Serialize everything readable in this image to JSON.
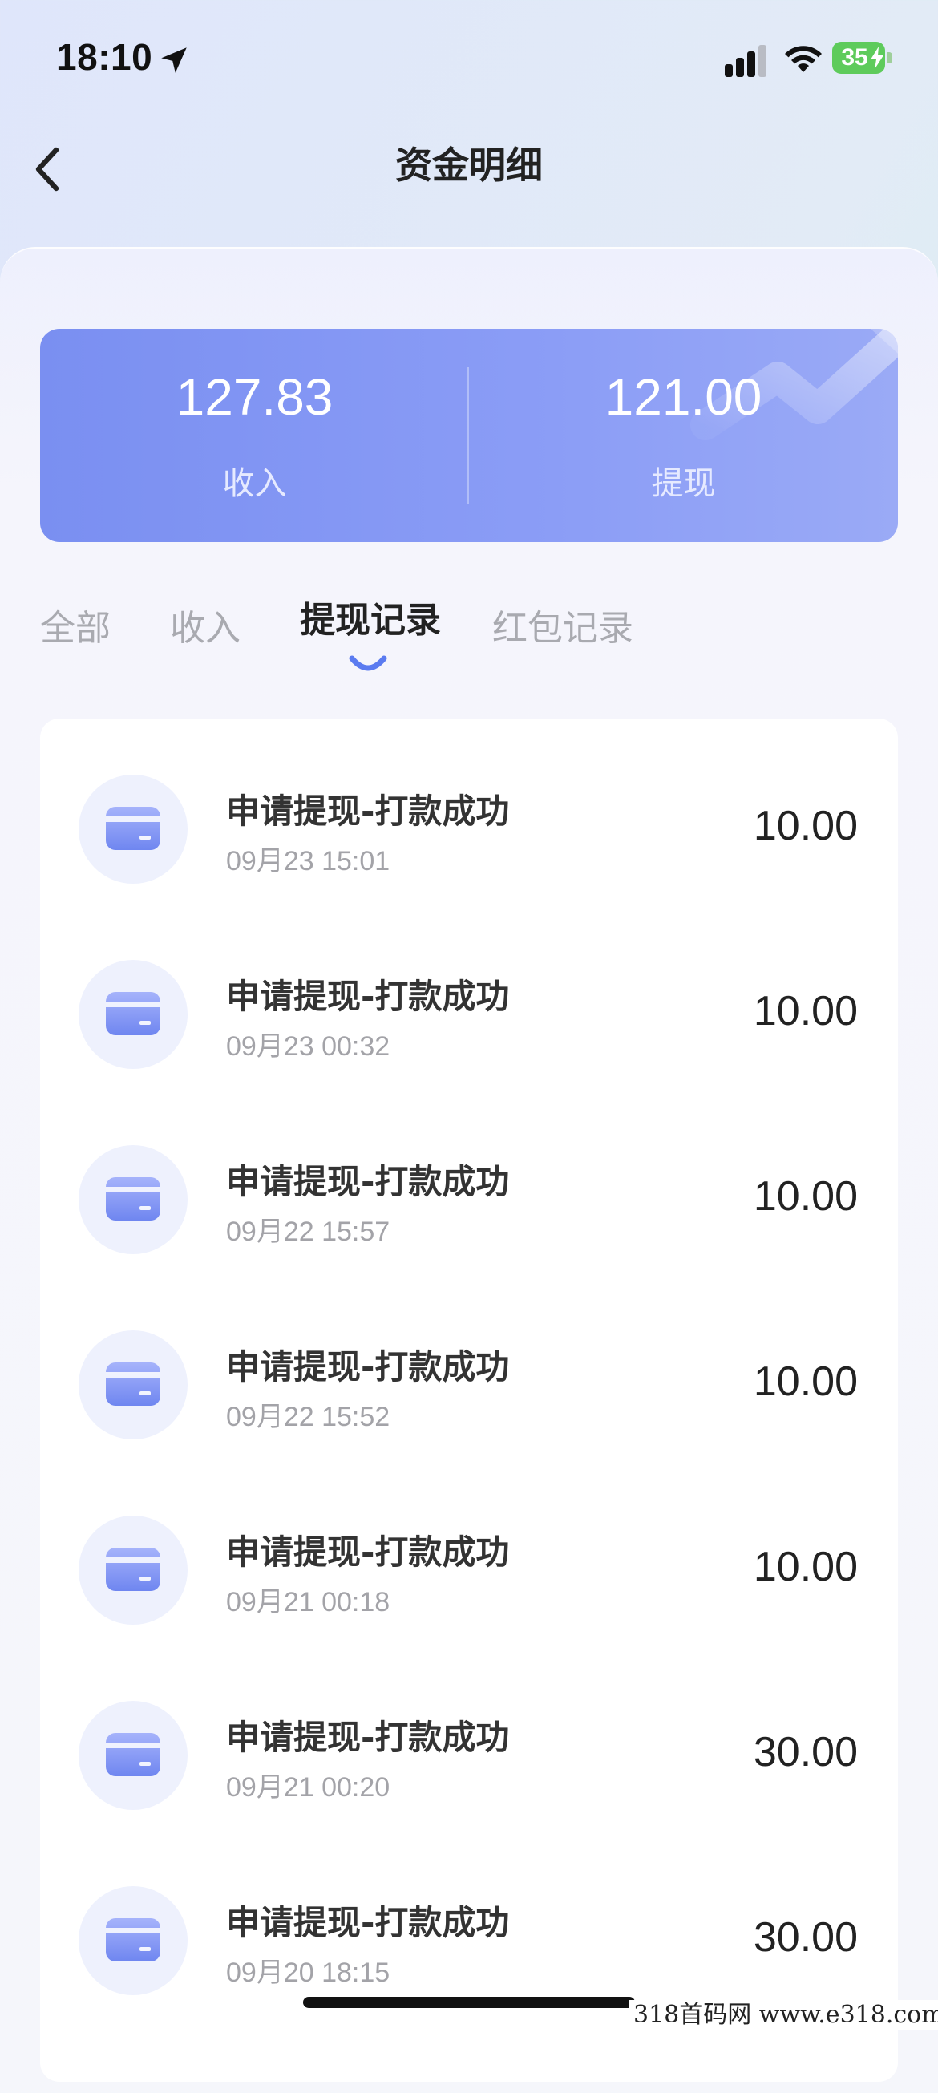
{
  "status_bar": {
    "time": "18:10",
    "battery": "35",
    "icons": [
      "location-arrow-icon",
      "cellular-signal-icon",
      "wifi-icon",
      "battery-charging-icon"
    ]
  },
  "nav": {
    "back_icon": "chevron-left-icon",
    "title": "资金明细"
  },
  "summary": {
    "income_value": "127.83",
    "income_label": "收入",
    "withdraw_value": "121.00",
    "withdraw_label": "提现"
  },
  "tabs": [
    {
      "label": "全部",
      "active": false
    },
    {
      "label": "收入",
      "active": false
    },
    {
      "label": "提现记录",
      "active": true
    },
    {
      "label": "红包记录",
      "active": false
    }
  ],
  "records": [
    {
      "title": "申请提现-打款成功",
      "time": "09月23 15:01",
      "amount": "10.00"
    },
    {
      "title": "申请提现-打款成功",
      "time": "09月23 00:32",
      "amount": "10.00"
    },
    {
      "title": "申请提现-打款成功",
      "time": "09月22 15:57",
      "amount": "10.00"
    },
    {
      "title": "申请提现-打款成功",
      "time": "09月22 15:52",
      "amount": "10.00"
    },
    {
      "title": "申请提现-打款成功",
      "time": "09月21 00:18",
      "amount": "10.00"
    },
    {
      "title": "申请提现-打款成功",
      "time": "09月21 00:20",
      "amount": "30.00"
    },
    {
      "title": "申请提现-打款成功",
      "time": "09月20 18:15",
      "amount": "30.00"
    }
  ],
  "watermark": "318首码网 www.e318.com",
  "colors": {
    "card_gradient_start": "#7a8ff1",
    "card_gradient_end": "#9aaaf6",
    "accent": "#5b7bf0",
    "battery_green": "#5ecb5b"
  }
}
